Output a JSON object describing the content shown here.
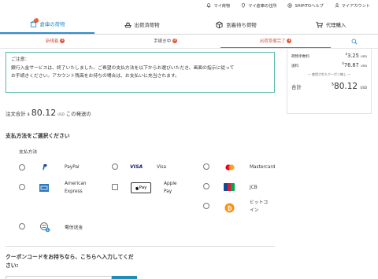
{
  "header": {
    "links": [
      {
        "icon": "bell-icon",
        "label": "マイ荷物"
      },
      {
        "icon": "location-pin-icon",
        "label": "マイ倉庫の住所"
      },
      {
        "icon": "help-icon",
        "label": "SHIPITOヘルプ"
      },
      {
        "icon": "user-icon",
        "label": "マイアカウント"
      }
    ]
  },
  "tabs": [
    {
      "label": "倉庫の荷物",
      "badge": "!",
      "active": true,
      "icon": "warehouse-icon"
    },
    {
      "label": "出荷済荷物",
      "icon": "ship-icon"
    },
    {
      "label": "到着待ち荷物",
      "icon": "package-icon"
    },
    {
      "label": "代理購入",
      "icon": "cart-icon"
    }
  ],
  "subtabs": [
    {
      "label": "新規着",
      "badge": "1"
    },
    {
      "label": "手続き中",
      "badge": "3"
    },
    {
      "label": "出荷準備完了",
      "badge": "1",
      "active": true
    }
  ],
  "notice": {
    "heading": "ご注意：",
    "line1": "銀行入金サービスは、終了いたしました。ご希望の支払方法を以下からお選びいただき、画面の指示に従って",
    "line2": "お手続きください。アカウント残高をお持ちの場合は、お支払いに充当されます。"
  },
  "summary": {
    "shipping_label": "荷物手数料",
    "shipping_value": "3.25",
    "freight_label": "送料",
    "freight_value": "76.87",
    "coupon_note": "— 使用されたクーポン無し —",
    "total_label": "合計",
    "total_value": "80.12",
    "currency": "USD",
    "dollar": "$"
  },
  "order_total": {
    "label": "注文合計",
    "dollar": "$",
    "amount": "80.12",
    "currency": "USD",
    "suffix": "この発送の"
  },
  "payment": {
    "title": "支払方法をご選択ください",
    "method_label": "支払方法",
    "options": {
      "paypal": "PayPal",
      "visa": "Visa",
      "mastercard": "Mastercard",
      "amex_1": "American",
      "amex_2": "Express",
      "applepay_1": "Apple",
      "applepay_2": "Pay",
      "jcb": "JCB",
      "bitcoin_1": "ビットコ",
      "bitcoin_2": "イン",
      "wire": "電信送金"
    },
    "logos": {
      "visa": "VISA",
      "applepay": "Pay",
      "jcb": "JCB"
    }
  },
  "coupon": {
    "title_1": "クーポンコードをお持ちなら、こちらへ入力してくだ",
    "title_2": "さい:"
  },
  "colors": {
    "accent": "#2f8fc7",
    "badge": "#e35a3c",
    "notice_border": "#5bb9ad"
  }
}
